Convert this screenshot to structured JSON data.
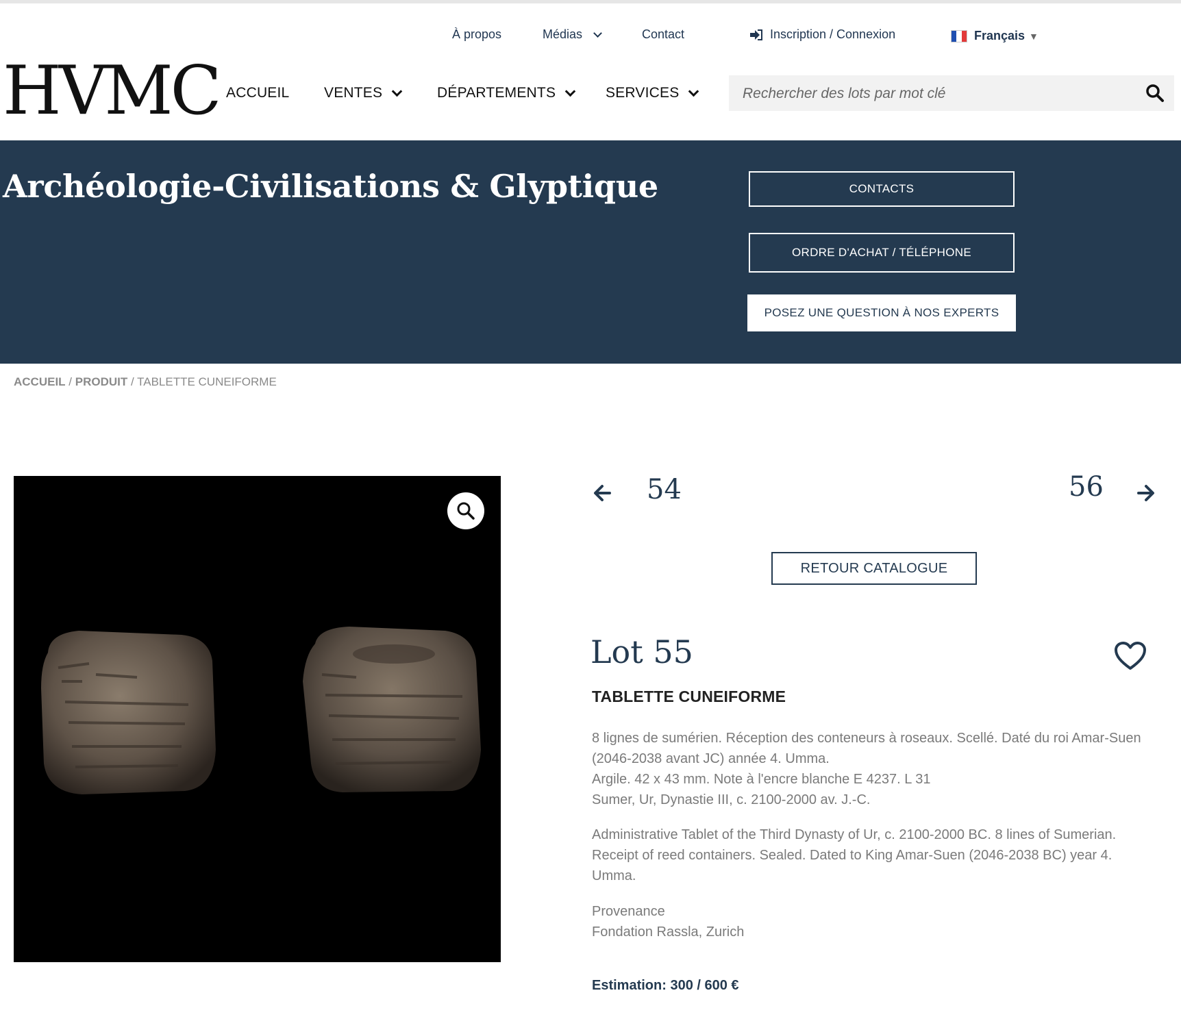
{
  "top_nav": {
    "about": "À propos",
    "media": "Médias",
    "contact": "Contact",
    "login": "Inscription / Connexion",
    "language": "Français"
  },
  "logo": "HVMC",
  "main_nav": {
    "home": "ACCUEIL",
    "sales": "VENTES",
    "departments": "DÉPARTEMENTS",
    "services": "SERVICES"
  },
  "search": {
    "placeholder": "Rechercher des lots par mot clé"
  },
  "hero": {
    "title": "Archéologie-Civilisations & Glyptique",
    "buttons": {
      "contacts": "CONTACTS",
      "purchase_order": "ORDRE D'ACHAT / TÉLÉPHONE",
      "ask_experts": "POSEZ UNE QUESTION À NOS EXPERTS"
    }
  },
  "breadcrumb": {
    "home": "ACCUEIL",
    "sep1": " / ",
    "product": "PRODUIT",
    "sep2": " / ",
    "current": "TABLETTE CUNEIFORME"
  },
  "lot_nav": {
    "prev": "54",
    "next": "56",
    "back": "RETOUR CATALOGUE"
  },
  "lot": {
    "title": "Lot 55",
    "name": "TABLETTE CUNEIFORME",
    "desc_fr": "8 lignes de sumérien. Réception des conteneurs à roseaux. Scellé. Daté du roi Amar-Suen (2046-2038 avant JC) année 4. Umma.",
    "desc_material": "Argile. 42 x 43 mm. Note à l'encre blanche E 4237. L 31",
    "desc_origin": "Sumer, Ur, Dynastie III, c. 2100-2000 av. J.-C.",
    "desc_en": "Administrative Tablet of the Third Dynasty of Ur, c. 2100-2000 BC. 8 lines of Sumerian. Receipt of reed containers. Sealed. Dated to King Amar-Suen (2046-2038 BC) year 4. Umma.",
    "provenance_label": "Provenance",
    "provenance_value": "Fondation Rassla, Zurich",
    "estimate": "Estimation: 300 / 600 €"
  },
  "colors": {
    "navy": "#243a50",
    "text_gray": "#7a7a7a"
  }
}
